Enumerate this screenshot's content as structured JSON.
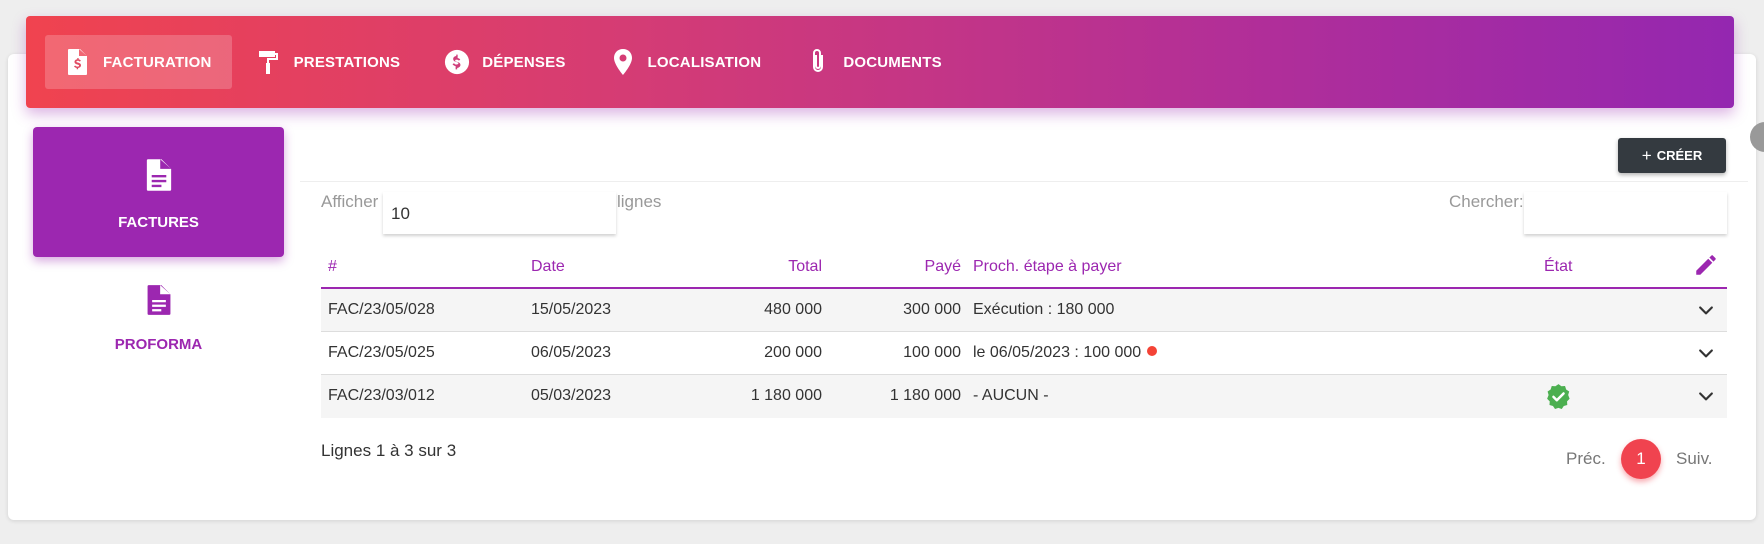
{
  "nav": {
    "items": [
      {
        "label": "FACTURATION",
        "icon": "invoice-dollar-icon",
        "active": true
      },
      {
        "label": "PRESTATIONS",
        "icon": "paint-roller-icon",
        "active": false
      },
      {
        "label": "DÉPENSES",
        "icon": "dollar-circle-icon",
        "active": false
      },
      {
        "label": "LOCALISATION",
        "icon": "map-pin-icon",
        "active": false
      },
      {
        "label": "DOCUMENTS",
        "icon": "paperclip-icon",
        "active": false
      }
    ]
  },
  "sidebar": {
    "items": [
      {
        "label": "FACTURES",
        "icon": "document-icon",
        "active": true
      },
      {
        "label": "PROFORMA",
        "icon": "document-icon",
        "active": false
      }
    ]
  },
  "toolbar": {
    "create_label": "CRÉER"
  },
  "controls": {
    "show_label": "Afficher",
    "rows_per_page": "10",
    "rows_label": "lignes",
    "search_label": "Chercher:",
    "search_value": ""
  },
  "table": {
    "columns": [
      "#",
      "Date",
      "Total",
      "Payé",
      "Proch. étape à payer",
      "État"
    ],
    "rows": [
      {
        "num": "FAC/23/05/028",
        "date": "15/05/2023",
        "total": "480 000",
        "paid": "300 000",
        "next_step": "Exécution : 180 000",
        "overdue": false,
        "status": ""
      },
      {
        "num": "FAC/23/05/025",
        "date": "06/05/2023",
        "total": "200 000",
        "paid": "100 000",
        "next_step": "le 06/05/2023 : 100 000",
        "overdue": true,
        "status": ""
      },
      {
        "num": "FAC/23/03/012",
        "date": "05/03/2023",
        "total": "1 180 000",
        "paid": "1 180 000",
        "next_step": "- AUCUN -",
        "overdue": false,
        "status": "paid-check"
      }
    ]
  },
  "pagination": {
    "info": "Lignes 1 à 3 sur 3",
    "prev_label": "Préc.",
    "current_page": "1",
    "next_label": "Suiv."
  },
  "colors": {
    "accent": "#9c27b0",
    "gradient_start": "#f0434f",
    "gradient_end": "#9427b0",
    "dark_button": "#343a40",
    "success": "#4caf50",
    "danger": "#f44336"
  }
}
